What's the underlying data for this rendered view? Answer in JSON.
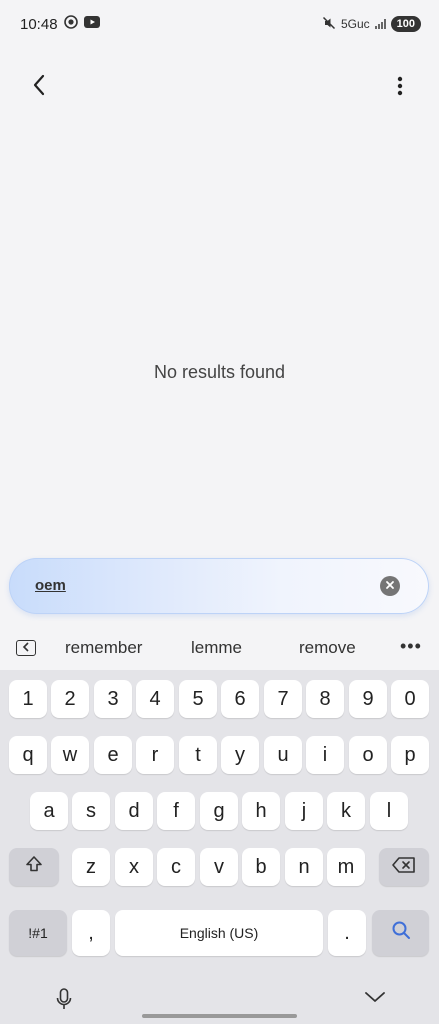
{
  "status_bar": {
    "time": "10:48",
    "network": "5Guc",
    "battery": "100"
  },
  "empty_state": {
    "message": "No results found"
  },
  "search": {
    "query": "oem"
  },
  "suggestions": [
    "remember",
    "lemme",
    "remove"
  ],
  "keyboard": {
    "number_row": [
      "1",
      "2",
      "3",
      "4",
      "5",
      "6",
      "7",
      "8",
      "9",
      "0"
    ],
    "row1": [
      "q",
      "w",
      "e",
      "r",
      "t",
      "y",
      "u",
      "i",
      "o",
      "p"
    ],
    "row2": [
      "a",
      "s",
      "d",
      "f",
      "g",
      "h",
      "j",
      "k",
      "l"
    ],
    "row3": [
      "z",
      "x",
      "c",
      "v",
      "b",
      "n",
      "m"
    ],
    "symbols_label": "!#1",
    "comma": ",",
    "space_label": "English (US)",
    "period": "."
  },
  "icons": {
    "back": "chevron-left-icon",
    "more": "more-vert-icon",
    "clear": "clear-circle-icon",
    "search_key": "search-icon",
    "shift": "shift-icon",
    "backspace": "backspace-icon",
    "mic": "mic-icon",
    "hide_keyboard": "chevron-down-icon"
  },
  "colors": {
    "accent": "#3f6fd8",
    "background": "#f4f4f6",
    "keyboard_bg": "#e4e4e8"
  }
}
